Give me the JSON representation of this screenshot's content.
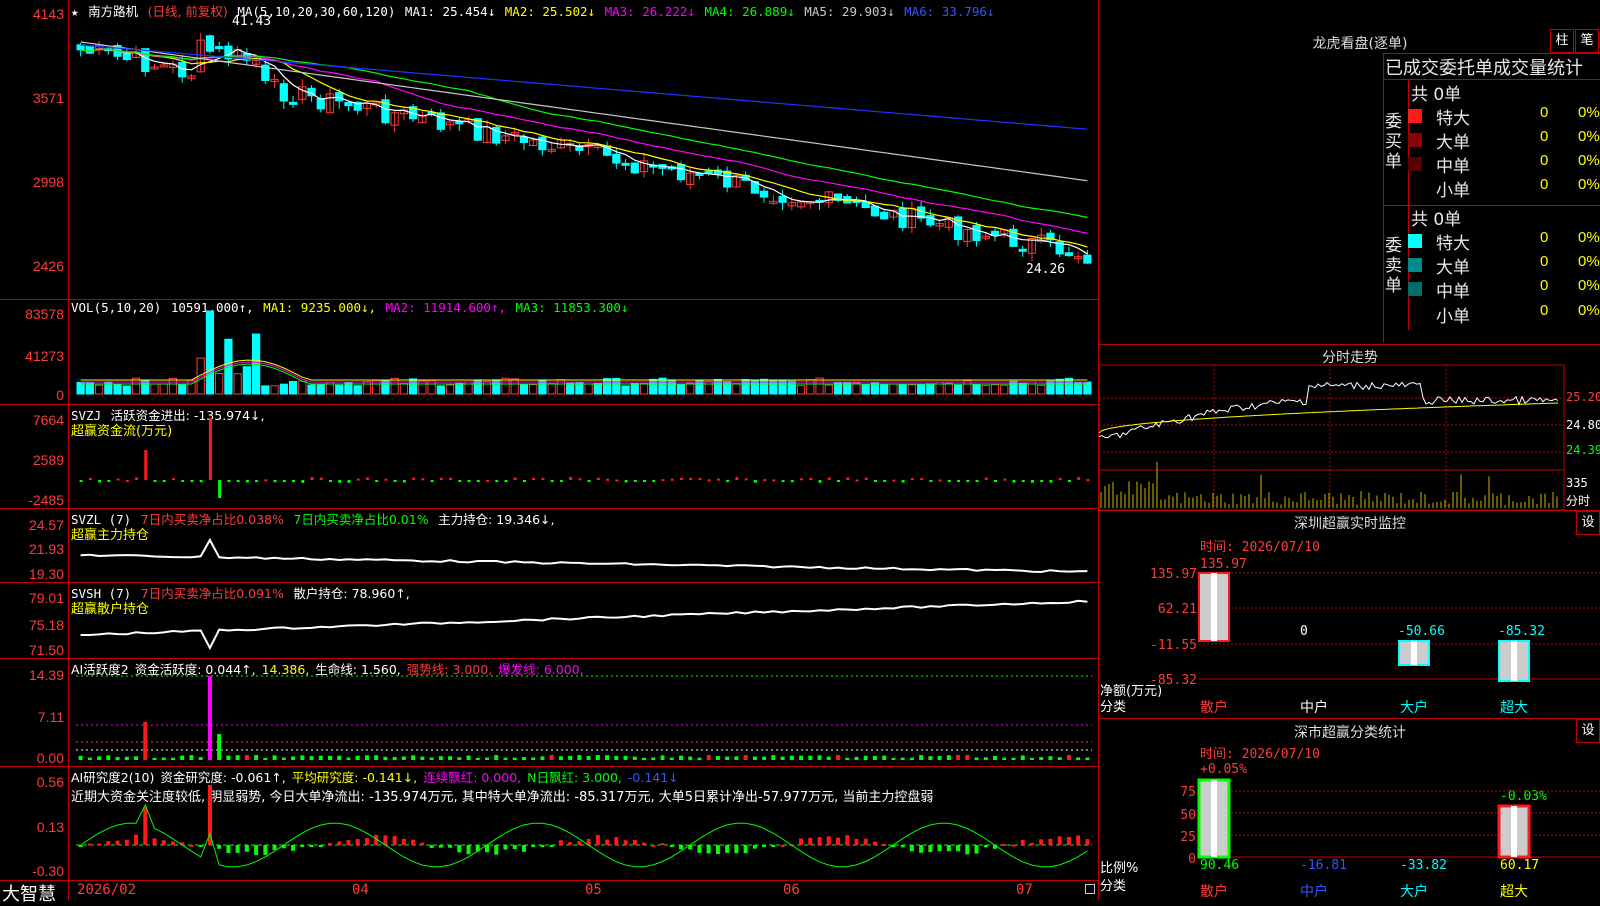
{
  "left_axis": {
    "price": [
      "4143",
      "3571",
      "2998",
      "2426"
    ],
    "vol": [
      "83578",
      "41273",
      "0"
    ],
    "svzj": [
      "7664",
      "2589",
      "-2485"
    ],
    "svzl": [
      "24.57",
      "21.93",
      "19.30"
    ],
    "svsh": [
      "79.01",
      "75.18",
      "71.50"
    ],
    "ai_activity": [
      "14.39",
      "7.11",
      "0.00"
    ],
    "ai_research": [
      "0.56",
      "0.13",
      "-0.30"
    ]
  },
  "main_header": {
    "star": "★",
    "name": "南方路机",
    "mode": "(日线, 前复权)",
    "ma_def": "MA(5,10,20,30,60,120)",
    "ma1": "MA1: 25.454↓",
    "ma2": "MA2: 25.502↓",
    "ma3": "MA3: 26.222↓",
    "ma4": "MA4: 26.889↓",
    "ma5": "MA5: 29.903↓",
    "ma6": "MA6: 33.796↓",
    "high_mark": "41.43",
    "low_mark": "24.26",
    "colors": {
      "ma1": "#ffffff",
      "ma2": "#ffff00",
      "ma3": "#ff00ff",
      "ma4": "#00ff00",
      "ma5": "#c8c8c8",
      "ma6": "#2233ff"
    }
  },
  "vol_header": {
    "def": "VOL(5,10,20)",
    "value": "10591.000↑,",
    "ma1": "MA1: 9235.000↓,",
    "ma2": "MA2: 11914.600↑,",
    "ma3": "MA3: 11853.300↓"
  },
  "svzj_header": {
    "def": "SVZJ",
    "active": "活跃资金进出: -135.974↓,",
    "subtitle": "超赢资金流(万元)"
  },
  "svzl_header": {
    "def": "SVZL (7)",
    "a": "7日内买卖净占比0.038%",
    "b": "7日内买卖净占比0.01%",
    "c": "主力持仓: 19.346↓,",
    "subtitle": "超赢主力持仓"
  },
  "svsh_header": {
    "def": "SVSH (7)",
    "a": "7日内买卖净占比0.091%",
    "b": "散户持仓: 78.960↑,",
    "subtitle": "超赢散户持仓"
  },
  "ai1_header": {
    "def": "AI活跃度2",
    "a": "资金活跃度: 0.044↑,",
    "b": "14.386,",
    "c": "生命线: 1.560,",
    "d": "强势线: 3.000,",
    "e": "爆发线: 6.000,"
  },
  "ai2_header": {
    "def": "AI研究度2(10)",
    "a": "资金研究度: -0.061↑,",
    "b": "平均研究度: -0.141↓,",
    "c": "连续飘红: 0.000,",
    "d": "N日飘红: 3.000,",
    "e": "-0.141↓",
    "comment": "近期大资金关注度较低, 明显弱势, 今日大单净流出: -135.974万元, 其中特大单净流出: -85.317万元, 大单5日累计净出-57.977万元, 当前主力控盘弱"
  },
  "bottom_bar": {
    "brand": "大智慧",
    "dates": [
      "2026/02",
      "04",
      "05",
      "06",
      "07"
    ]
  },
  "dragon_tiger": {
    "title": "龙虎看盘(逐单)",
    "btn_bar": "柱",
    "btn_tick": "笔",
    "subtitle": "已成交委托单成交量统计",
    "buy": {
      "side_label": "委买单",
      "total": "共 0单",
      "rows": [
        {
          "name": "特大",
          "count": "0",
          "pct": "0%"
        },
        {
          "name": "大单",
          "count": "0",
          "pct": "0%"
        },
        {
          "name": "中单",
          "count": "0",
          "pct": "0%"
        },
        {
          "name": "小单",
          "count": "0",
          "pct": "0%"
        }
      ]
    },
    "sell": {
      "side_label": "委卖单",
      "total": "共 0单",
      "rows": [
        {
          "name": "特大",
          "count": "0",
          "pct": "0%"
        },
        {
          "name": "大单",
          "count": "0",
          "pct": "0%"
        },
        {
          "name": "中单",
          "count": "0",
          "pct": "0%"
        },
        {
          "name": "小单",
          "count": "0",
          "pct": "0%"
        }
      ]
    }
  },
  "intraday": {
    "title": "分时走势",
    "prices": [
      "25.20",
      "24.80",
      "24.39"
    ],
    "vol_label": "335",
    "vol_unit": "分时"
  },
  "sz_monitor": {
    "title": "深圳超赢实时监控",
    "settings": "设",
    "time": "时间: 2026/07/10",
    "axis": [
      "135.97",
      "62.21",
      "-11.55",
      "-85.32"
    ],
    "ylabel": "净额(万元)",
    "xlabel": "分类",
    "categories": [
      "散户",
      "中户",
      "大户",
      "超大"
    ],
    "values": [
      "135.97",
      "0",
      "-50.66",
      "-85.32"
    ]
  },
  "sz_category": {
    "title": "深市超赢分类统计",
    "settings": "设",
    "time": "时间: 2026/07/10",
    "axis": [
      "75",
      "50",
      "25",
      "0"
    ],
    "ylabel": "比例%",
    "xlabel": "分类",
    "categories": [
      "散户",
      "中户",
      "大户",
      "超大"
    ],
    "top_labels": [
      "+0.05%",
      "",
      "",
      "-0.03%"
    ],
    "values": [
      "90.46",
      "-16.81",
      "-33.82",
      "60.17"
    ]
  },
  "chart_data": {
    "type": "candlestick",
    "symbol": "南方路机",
    "x_ticks": [
      "2026/02",
      "04",
      "05",
      "06",
      "07"
    ],
    "price_axis": [
      2426,
      2998,
      3571,
      4143
    ],
    "volume_axis": [
      0,
      41273,
      83578
    ],
    "indicators": {
      "MA1": 25.454,
      "MA2": 25.502,
      "MA3": 26.222,
      "MA4": 26.889,
      "MA5": 29.903,
      "MA6": 33.796,
      "VOL": 10591.0,
      "VOL_MA1": 9235.0,
      "VOL_MA2": 11914.6,
      "VOL_MA3": 11853.3,
      "active_fund_flow": -135.974,
      "main_position": 19.346,
      "retail_position": 78.96,
      "fund_activity": 0.044,
      "fund_research": -0.061,
      "avg_research": -0.141
    },
    "annotations": [
      "41.43",
      "24.26"
    ],
    "sz_realtime_monitor": {
      "categories": [
        "散户",
        "中户",
        "大户",
        "超大"
      ],
      "values": [
        135.97,
        0,
        -50.66,
        -85.32
      ]
    },
    "sz_category_stats": {
      "categories": [
        "散户",
        "中户",
        "大户",
        "超大"
      ],
      "values": [
        90.46,
        -16.81,
        -33.82,
        60.17
      ]
    }
  }
}
